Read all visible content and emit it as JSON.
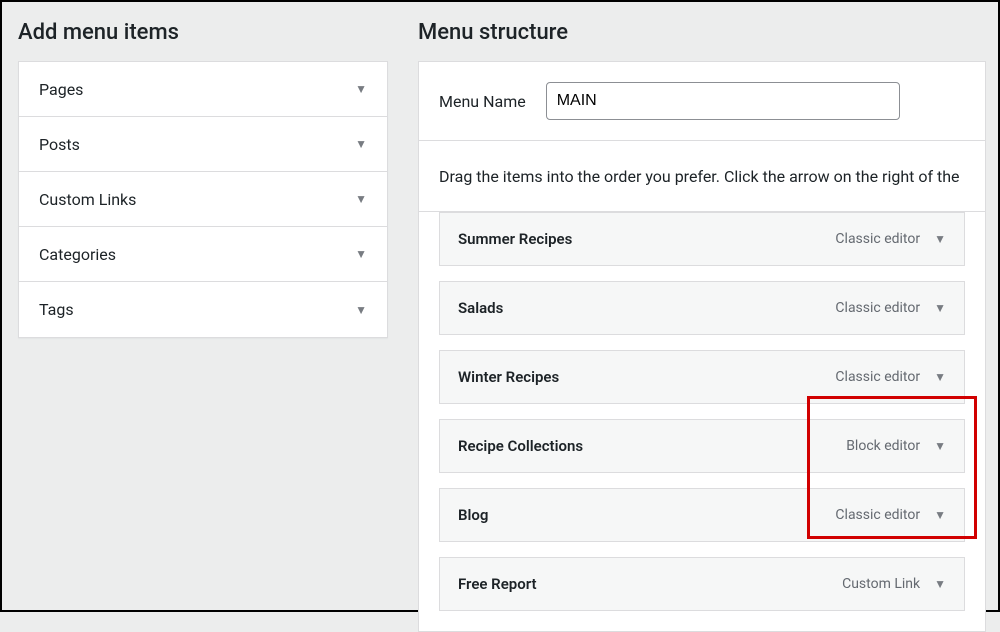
{
  "left": {
    "heading": "Add menu items",
    "accordion": [
      "Pages",
      "Posts",
      "Custom Links",
      "Categories",
      "Tags"
    ]
  },
  "right": {
    "heading": "Menu structure",
    "menu_name_label": "Menu Name",
    "menu_name_value": "MAIN",
    "instructions": "Drag the items into the order you prefer. Click the arrow on the right of the",
    "items": [
      {
        "title": "Summer Recipes",
        "type": "Classic editor"
      },
      {
        "title": "Salads",
        "type": "Classic editor"
      },
      {
        "title": "Winter Recipes",
        "type": "Classic editor"
      },
      {
        "title": "Recipe Collections",
        "type": "Block editor"
      },
      {
        "title": "Blog",
        "type": "Classic editor"
      },
      {
        "title": "Free Report",
        "type": "Custom Link"
      }
    ]
  }
}
